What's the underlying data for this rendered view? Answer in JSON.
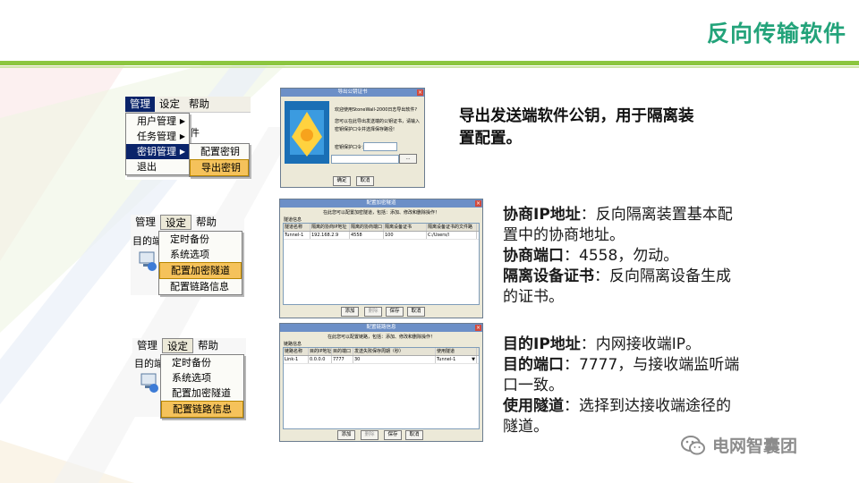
{
  "slide": {
    "title": "反向传输软件",
    "accent_color": "#23a37a",
    "band_color": "#8cc63f"
  },
  "block1": {
    "menubar": [
      "管理",
      "设定",
      "帮助"
    ],
    "menu_items": [
      "用户管理",
      "任务管理",
      "密钥管理",
      "退出"
    ],
    "ghost_text": "件",
    "submenu": [
      "配置密钥",
      "导出密钥"
    ],
    "dialog": {
      "title": "导出公钥证书",
      "line1": "欢迎使用StoneWall-2000日志导出软件?",
      "line2": "您可以在此导出发送端的公钥证书，请输入",
      "line3": "密钥保护口令并选择保存路径!",
      "pwd_label": "密钥保护口令：",
      "browse": "...",
      "ok": "确定",
      "cancel": "取消"
    },
    "description": "导出发送端软件公钥，用于隔离装置配置。"
  },
  "block2": {
    "menubar": [
      "管理",
      "设定",
      "帮助"
    ],
    "ghost_text": "目的端",
    "menu_items": [
      "定时备份",
      "系统选项",
      "配置加密隧道",
      "配置链路信息"
    ],
    "dialog": {
      "title": "配置加密隧道",
      "subtitle": "在此您可以配置加密隧道，包括：添加、修改和删除操作！",
      "group": "隧道信息",
      "columns": [
        "隧道名称",
        "隔离的协商IP地址",
        "隔离的协商端口",
        "隔离设备证书",
        "隔离设备证书的文件路"
      ],
      "row": [
        "Tunnel-1",
        "192.168.2.9",
        "4558",
        "100",
        "C:/Users/l"
      ],
      "buttons": [
        "添加",
        "删除",
        "保存",
        "取消"
      ]
    },
    "desc": {
      "k1": "协商IP地址",
      "v1": "：反向隔离装置基本配置中的协商地址。",
      "k2": "协商端口",
      "v2": "：4558，勿动。",
      "k3": "隔离设备证书",
      "v3": "：反向隔离设备生成的证书。"
    }
  },
  "block3": {
    "menubar": [
      "管理",
      "设定",
      "帮助"
    ],
    "ghost_text": "目的端",
    "menu_items": [
      "定时备份",
      "系统选项",
      "配置加密隧道",
      "配置链路信息"
    ],
    "dialog": {
      "title": "配置链路信息",
      "subtitle": "在此您可以配置链路，包括：添加、修改和删除操作！",
      "group": "链路信息",
      "columns": [
        "链路名称",
        "目的IP地址",
        "目的端口",
        "发送失败保存周期（秒）",
        "使用隧道"
      ],
      "row": [
        "Link-1",
        "0.0.0.0",
        "7777",
        "30",
        "Tunnel-1"
      ],
      "buttons": [
        "添加",
        "删除",
        "保存",
        "取消"
      ]
    },
    "desc": {
      "k1": "目的IP地址",
      "v1": "：内网接收端IP。",
      "k2": "目的端口",
      "v2": "：7777，与接收端监听端口一致。",
      "k3": "使用隧道",
      "v3": "：选择到达接收端途径的隧道。"
    }
  },
  "watermark": {
    "text": "电网智囊团",
    "icon": "wechat-icon"
  }
}
